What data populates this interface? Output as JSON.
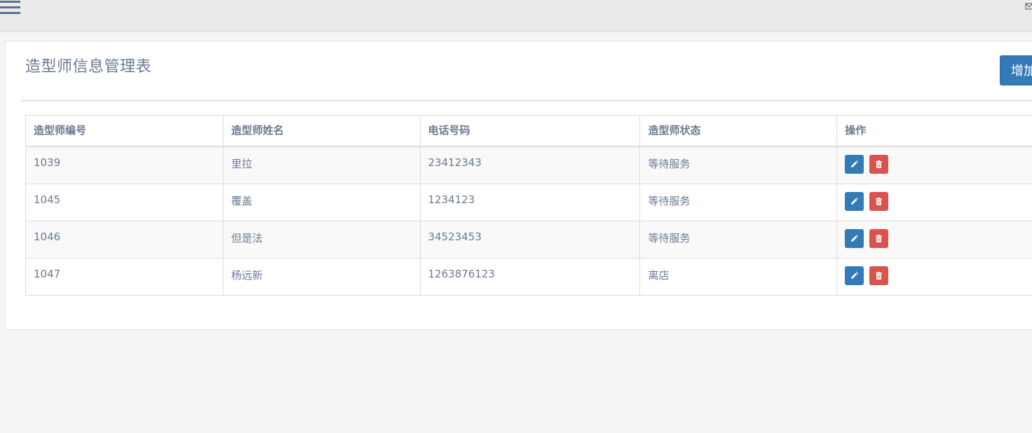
{
  "topbar": {
    "menu_icon": "hamburger-menu-icon",
    "mail_icon": "envelope-icon"
  },
  "page": {
    "title": "造型师信息管理表",
    "add_button_label": "增加"
  },
  "table": {
    "headers": [
      "造型师编号",
      "造型师姓名",
      "电话号码",
      "造型师状态",
      "操作"
    ],
    "rows": [
      {
        "id": "1039",
        "name": "里拉",
        "phone": "23412343",
        "status": "等待服务"
      },
      {
        "id": "1045",
        "name": "覆盖",
        "phone": "1234123",
        "status": "等待服务"
      },
      {
        "id": "1046",
        "name": "但是法",
        "phone": "34523453",
        "status": "等待服务"
      },
      {
        "id": "1047",
        "name": "杨远新",
        "phone": "1263876123",
        "status": "离店"
      }
    ],
    "row_actions": {
      "edit_icon": "pencil-icon",
      "delete_icon": "trash-icon"
    }
  },
  "colors": {
    "primary": "#337ab7",
    "danger": "#d9534f",
    "text": "#6b7a90"
  }
}
